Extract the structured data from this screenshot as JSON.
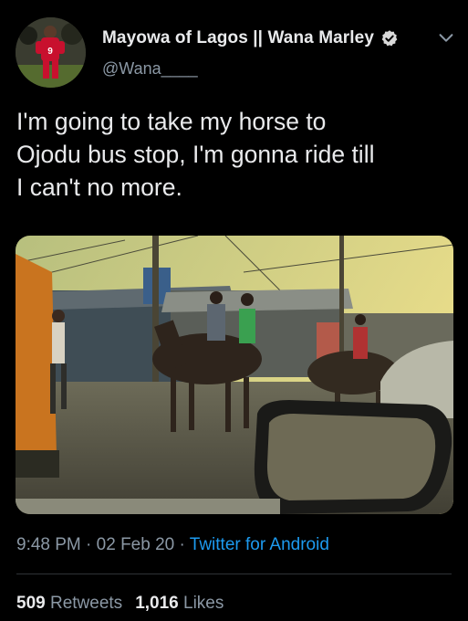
{
  "author": {
    "display_name": "Mayowa of Lagos || Wana Marley",
    "handle": "@Wana____",
    "avatar_jersey_number": "9"
  },
  "tweet": {
    "text": "I'm going to take my horse to\nOjodu bus stop, I'm gonna ride till\nI can't no more."
  },
  "meta": {
    "time": "9:48 PM",
    "separator": " · ",
    "date": "02 Feb 20",
    "source": "Twitter for Android"
  },
  "stats": {
    "retweets_count": "509",
    "retweets_label": "Retweets",
    "likes_count": "1,016",
    "likes_label": "Likes"
  },
  "icons": {
    "verified": "verified-badge-icon",
    "more": "chevron-down-icon"
  },
  "colors": {
    "background": "#000000",
    "link": "#1d9bf0",
    "muted": "#8b98a5"
  }
}
